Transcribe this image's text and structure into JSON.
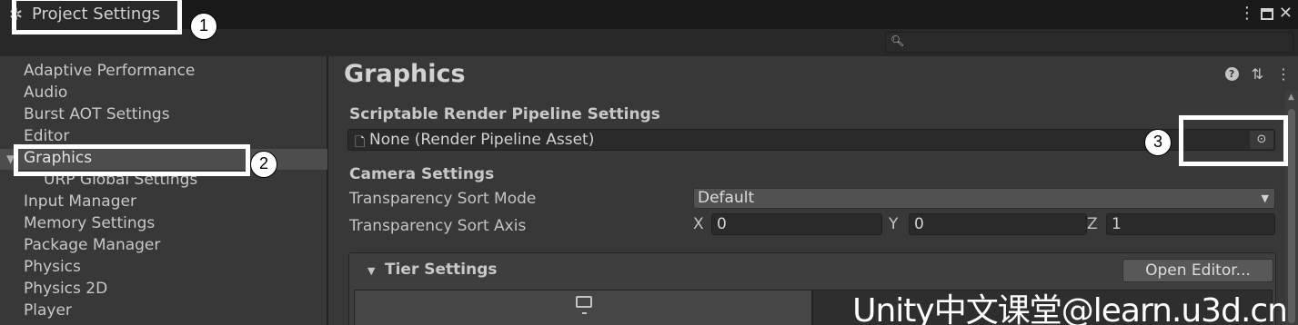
{
  "window": {
    "title": "Project Settings",
    "controls": {
      "menu": "⋮",
      "close": "✕"
    }
  },
  "search": {
    "placeholder": "",
    "value": ""
  },
  "sidebar": {
    "items": [
      "Adaptive Performance",
      "Audio",
      "Burst AOT Settings",
      "Editor",
      "Graphics",
      "URP Global Settings",
      "Input Manager",
      "Memory Settings",
      "Package Manager",
      "Physics",
      "Physics 2D",
      "Player"
    ],
    "selected": "Graphics"
  },
  "content": {
    "title": "Graphics",
    "srp_header": "Scriptable Render Pipeline Settings",
    "srp_value": "None (Render Pipeline Asset)",
    "camera_header": "Camera Settings",
    "sort_mode_label": "Transparency Sort Mode",
    "sort_mode_value": "Default",
    "sort_axis_label": "Transparency Sort Axis",
    "axis": {
      "x_label": "X",
      "x": "0",
      "y_label": "Y",
      "y": "0",
      "z_label": "Z",
      "z": "1"
    },
    "tier_header": "Tier Settings",
    "open_editor": "Open Editor..."
  },
  "annotations": {
    "one": "1",
    "two": "2",
    "three": "3"
  },
  "watermark": "Unity中文课堂@learn.u3d.cn",
  "colors": {
    "callout": "#ffffff",
    "selected": "#4d4d4d",
    "background": "#383838"
  }
}
